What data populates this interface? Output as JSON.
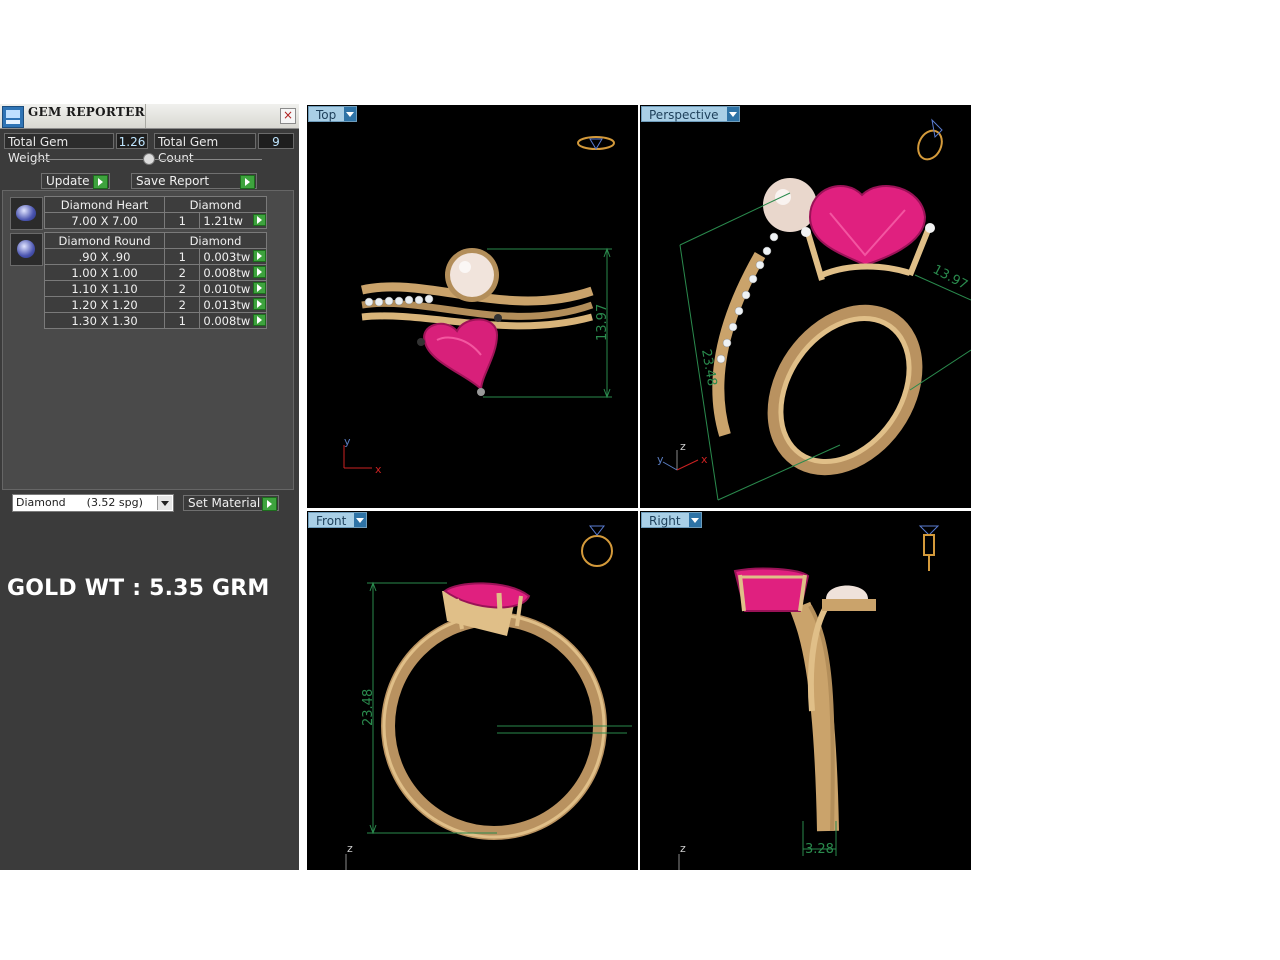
{
  "window": {
    "title": "GEM REPORTER",
    "close_glyph": "×"
  },
  "stats": {
    "total_weight_label": "Total Gem Weight",
    "total_weight_value": "1.26",
    "total_count_label": "Total Gem Count",
    "total_count_value": "9"
  },
  "actions": {
    "update_label": "Update",
    "save_report_label": "Save Report"
  },
  "gem_groups": [
    {
      "shape": "Diamond Heart",
      "material": "Diamond",
      "rows": [
        {
          "size": "7.00 X 7.00",
          "count": "1",
          "weight": "1.21tw"
        }
      ]
    },
    {
      "shape": "Diamond Round",
      "material": "Diamond",
      "rows": [
        {
          "size": ".90 X .90",
          "count": "1",
          "weight": "0.003tw"
        },
        {
          "size": "1.00 X 1.00",
          "count": "2",
          "weight": "0.008tw"
        },
        {
          "size": "1.10 X 1.10",
          "count": "2",
          "weight": "0.010tw"
        },
        {
          "size": "1.20 X 1.20",
          "count": "2",
          "weight": "0.013tw"
        },
        {
          "size": "1.30 X 1.30",
          "count": "1",
          "weight": "0.008tw"
        }
      ]
    }
  ],
  "material_select": {
    "value": "Diamond      (3.52 spg)"
  },
  "set_material_label": "Set Material",
  "gold_weight": "GOLD WT : 5.35 GRM",
  "viewports": {
    "top": {
      "label": "Top",
      "dimension": "13.97",
      "axis_y": "y",
      "axis_x": "x"
    },
    "perspective": {
      "label": "Perspective",
      "dimension_a": "13.97",
      "dimension_b": "23.48",
      "axis_x": "x",
      "axis_y": "y",
      "axis_z": "z"
    },
    "front": {
      "label": "Front",
      "dimension": "23.48",
      "axis_z": "z"
    },
    "right": {
      "label": "Right",
      "dimension": "3.28",
      "axis_z": "z"
    }
  },
  "colors": {
    "gold": "#d8b47a",
    "gem": "#e0207f",
    "pearl": "#f3e8e2",
    "dimension": "#2a8a4d",
    "viewport_bg": "#000000"
  }
}
